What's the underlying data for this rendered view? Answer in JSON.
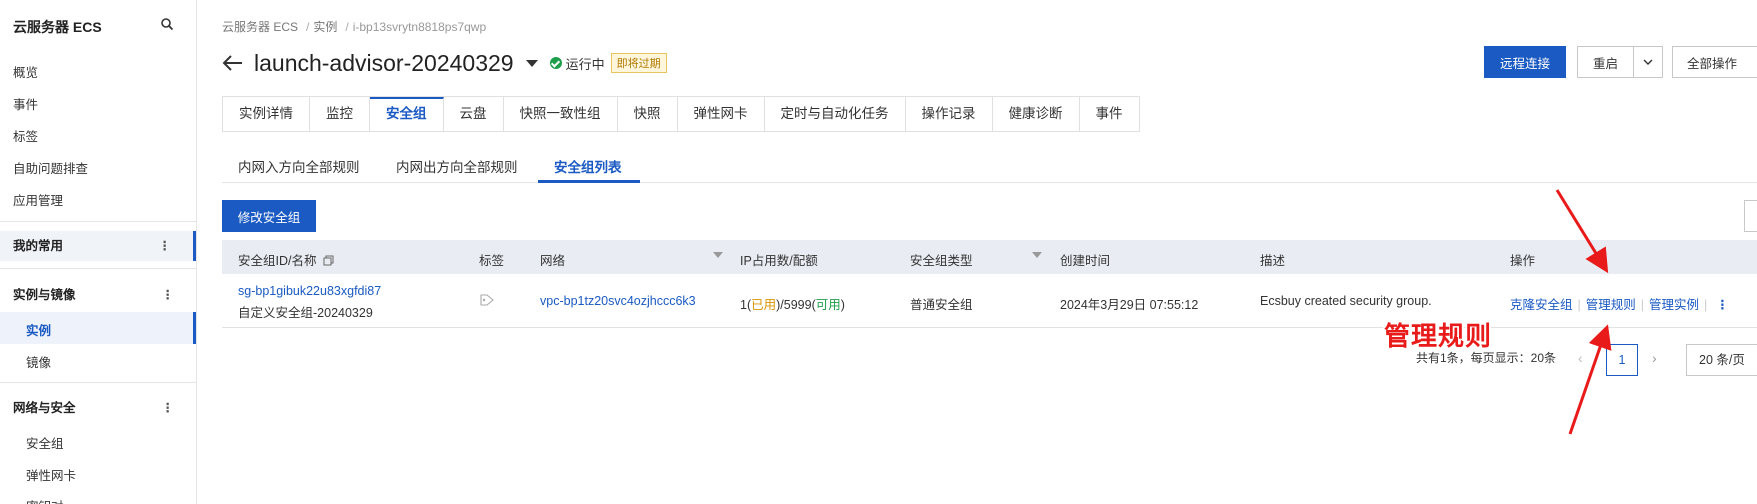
{
  "sidebar": {
    "title": "云服务器 ECS",
    "items": [
      "概览",
      "事件",
      "标签",
      "自助问题排查",
      "应用管理"
    ],
    "group_favorites": "我的常用",
    "group_instances": "实例与镜像",
    "instances_items": [
      "实例",
      "镜像"
    ],
    "group_network": "网络与安全",
    "network_items": [
      "安全组",
      "弹性网卡",
      "密钥对"
    ]
  },
  "breadcrumb": [
    "云服务器 ECS",
    "实例",
    "i-bp13svrytn8818ps7qwp"
  ],
  "header": {
    "title": "launch-advisor-20240329",
    "status": "运行中",
    "badge": "即将过期",
    "btn_remote": "远程连接",
    "btn_restart": "重启",
    "btn_all_ops": "全部操作"
  },
  "tabs": [
    "实例详情",
    "监控",
    "安全组",
    "云盘",
    "快照一致性组",
    "快照",
    "弹性网卡",
    "定时与自动化任务",
    "操作记录",
    "健康诊断",
    "事件"
  ],
  "active_tab": "安全组",
  "subtabs": [
    "内网入方向全部规则",
    "内网出方向全部规则",
    "安全组列表"
  ],
  "modify_btn": "修改安全组",
  "table": {
    "headers": [
      "安全组ID/名称",
      "标签",
      "网络",
      "IP占用数/配额",
      "安全组类型",
      "创建时间",
      "描述",
      "操作"
    ],
    "row": {
      "sg_id": "sg-bp1gibuk22u83xgfdi87",
      "sg_name": "自定义安全组-20240329",
      "network": "vpc-bp1tz20svc4ozjhccc6k3",
      "ip_used": "1",
      "ip_used_label": "已用",
      "ip_quota": "5999",
      "ip_avail_label": "可用",
      "sg_type": "普通安全组",
      "created": "2024年3月29日 07:55:12",
      "description": "Ecsbuy created security group.",
      "op_clone": "克隆安全组",
      "op_rules": "管理规则",
      "op_instances": "管理实例"
    }
  },
  "pagination": {
    "summary": "共有1条，每页显示：20条",
    "current_page": "1",
    "page_size": "20 条/页"
  },
  "annotation": {
    "label": "管理规则",
    "color": "#e81a1a"
  },
  "colors": {
    "primary": "#1a5ac2",
    "running": "#1e9e4a"
  }
}
